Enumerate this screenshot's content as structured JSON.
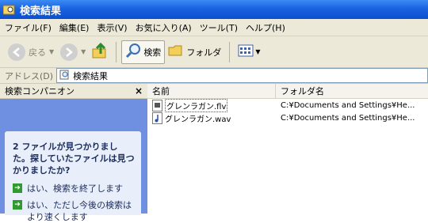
{
  "window": {
    "title": "検索結果"
  },
  "menu": [
    "ファイル(F)",
    "編集(E)",
    "表示(V)",
    "お気に入り(A)",
    "ツール(T)",
    "ヘルプ(H)"
  ],
  "toolbar": {
    "back": "戻る",
    "search": "検索",
    "folders": "フォルダ"
  },
  "address": {
    "label": "アドレス(D)",
    "value": "検索結果"
  },
  "left_pane": {
    "title": "検索コンパニオン",
    "close": "×",
    "message": "2 ファイルが見つかりました。探していたファイルは見つかりましたか?",
    "options": [
      "はい、検索を終了します",
      "はい、ただし今後の検索はより速くします"
    ]
  },
  "columns": {
    "name": "名前",
    "folder": "フォルダ名"
  },
  "files": [
    {
      "name": "グレンラガン.flv",
      "folder": "C:¥Documents and Settings¥He..."
    },
    {
      "name": "グレンラガン.wav",
      "folder": "C:¥Documents and Settings¥He..."
    }
  ],
  "colors": {
    "title_bar": "#0a4fd0",
    "chrome": "#ece9d8",
    "task_pane": "#6f8fe0"
  }
}
